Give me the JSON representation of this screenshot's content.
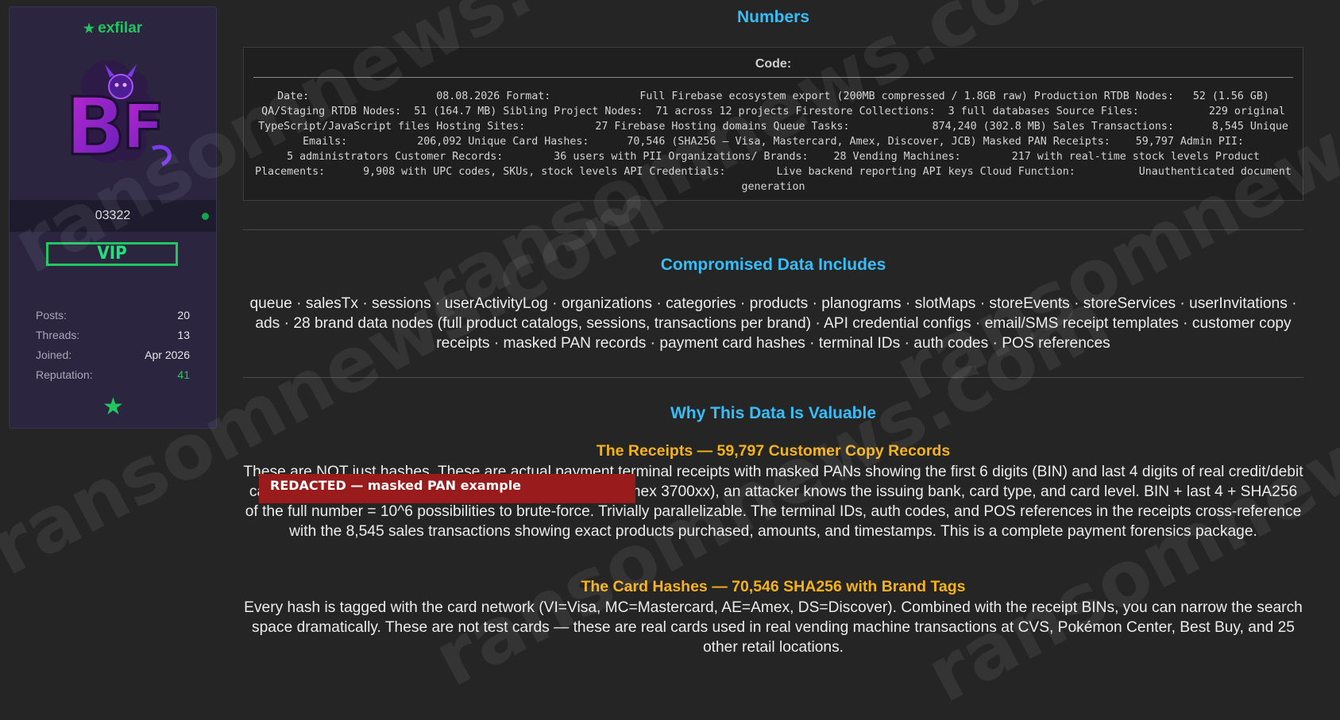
{
  "profile": {
    "username": "exfilar",
    "user_id": "03322",
    "badge": "VIP",
    "stats": [
      {
        "label": "Posts:",
        "value": "20"
      },
      {
        "label": "Threads:",
        "value": "13"
      },
      {
        "label": "Joined:",
        "value": "Apr 2026"
      },
      {
        "label": "Reputation:",
        "value": "41"
      }
    ],
    "avatar_letters": "BF"
  },
  "numbers": {
    "heading": "Numbers",
    "code_title": "Code:",
    "code_text": "Date:                    08.08.2026 Format:              Full Firebase ecosystem export (200MB compressed / 1.8GB raw) Production RTDB Nodes:   52 (1.56 GB) QA/Staging RTDB Nodes:  51 (164.7 MB) Sibling Project Nodes:  71 across 12 projects Firestore Collections:  3 full databases Source Files:           229 original TypeScript/JavaScript files Hosting Sites:           27 Firebase Hosting domains Queue Tasks:             874,240 (302.8 MB) Sales Transactions:      8,545 Unique Emails:           206,092 Unique Card Hashes:      70,546 (SHA256 — Visa, Mastercard, Amex, Discover, JCB) Masked PAN Receipts:    59,797 Admin PII:               5 administrators Customer Records:        36 users with PII Organizations/ Brands:    28 Vending Machines:        217 with real-time stock levels Product Placements:      9,908 with UPC codes, SKUs, stock levels API Credentials:        Live backend reporting API keys Cloud Function:          Unauthenticated document generation"
  },
  "compromised": {
    "heading": "Compromised Data Includes",
    "text": "queue · salesTx · sessions · userActivityLog · organizations · categories · products · planograms · slotMaps · storeEvents · storeServices · userInvitations · ads · 28 brand data nodes (full product catalogs, sessions, transactions per brand) · API credential configs · email/SMS receipt templates · customer copy receipts · masked PAN records · payment card hashes · terminal IDs · auth codes · POS references"
  },
  "valuable": {
    "heading": "Why This Data Is Valuable",
    "receipts_title": "The Receipts — 59,797 Customer Copy Records",
    "receipts_text": "These are NOT just hashes. These are actual payment terminal receipts with masked PANs showing the first 6 digits (BIN) and last 4 digits of real credit/debit cards. Format: identified (JCB 3540xx, Diners 3603xx, Amex 3700xx), an attacker knows the issuing bank, card type, and card level. BIN + last 4 + SHA256 of the full number = 10^6 possibilities to brute-force. Trivially parallelizable. The terminal IDs, auth codes, and POS references in the receipts cross-reference with the 8,545 sales transactions showing exact products purchased, amounts, and timestamps. This is a complete payment forensics package.",
    "redaction_label": "REDACTED — masked PAN example",
    "hashes_title": "The Card Hashes — 70,546 SHA256 with Brand Tags",
    "hashes_text": "Every hash is tagged with the card network (VI=Visa, MC=Mastercard, AE=Amex, DS=Discover). Combined with the receipt BINs, you can narrow the search space dramatically. These are not test cards — these are real cards used in real vending machine transactions at CVS, Pokémon Center, Best Buy, and 25 other retail locations."
  },
  "watermark": "ransomnews.com",
  "colors": {
    "accent_cyan": "#38bdf8",
    "accent_gold": "#f5b31b",
    "accent_green": "#22c55e",
    "redaction_red": "#991b1b"
  }
}
